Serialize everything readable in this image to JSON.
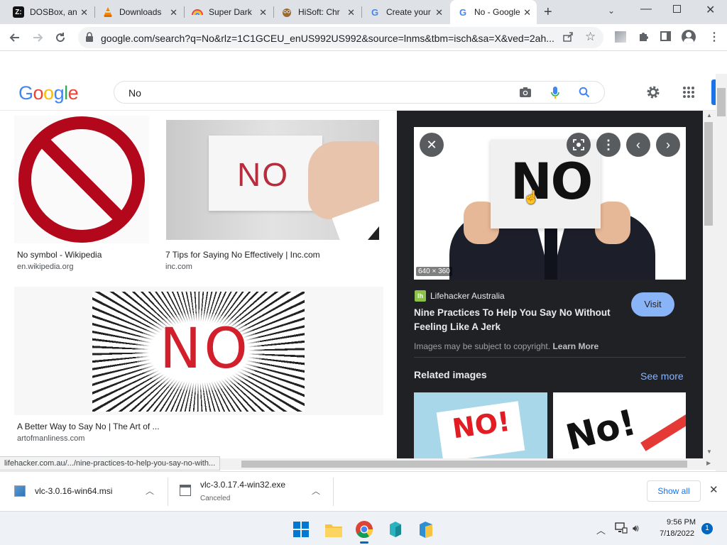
{
  "tabs": [
    {
      "title": "DOSBox, an",
      "icon": "dosbox-icon"
    },
    {
      "title": "Downloads",
      "icon": "vlc-icon"
    },
    {
      "title": "Super Dark",
      "icon": "rainbow-icon"
    },
    {
      "title": "HiSoft: Chr",
      "icon": "owl-icon"
    },
    {
      "title": "Create your",
      "icon": "google-icon"
    },
    {
      "title": "No - Google",
      "icon": "google-icon"
    }
  ],
  "url": "google.com/search?q=No&rlz=1C1GCEU_enUS992US992&source=lnms&tbm=isch&sa=X&ved=2ah...",
  "logo": {
    "g": "G",
    "o1": "o",
    "o2": "o",
    "g2": "g",
    "l": "l",
    "e": "e"
  },
  "search": {
    "query": "No"
  },
  "results": [
    {
      "title": "No symbol - Wikipedia",
      "source": "en.wikipedia.org"
    },
    {
      "title": "7 Tips for Saying No Effectively | Inc.com",
      "source": "inc.com"
    },
    {
      "title": "A Better Way to Say No | The Art of ...",
      "source": "artofmanliness.com"
    }
  ],
  "images": {
    "inc_text": "NO",
    "manly_text": "NO",
    "preview_text": "NO"
  },
  "panel": {
    "dimensions": "640 × 360",
    "site_name": "Lifehacker Australia",
    "site_logo_letter": "lh",
    "title_line1": "Nine Practices To Help You Say No Without",
    "title_line2": "Feeling Like A Jerk",
    "visit_label": "Visit",
    "copyright_text": "Images may be subject to copyright.",
    "learn_more": "Learn More",
    "related_label": "Related images",
    "see_more": "See more",
    "related1_text": "NO!",
    "related2_text": "No!"
  },
  "status_url": "lifehacker.com.au/.../nine-practices-to-help-you-say-no-with...",
  "downloads": [
    {
      "name": "vlc-3.0.16-win64.msi",
      "status": ""
    },
    {
      "name": "vlc-3.0.17.4-win32.exe",
      "status": "Canceled"
    }
  ],
  "show_all": "Show all",
  "clock": {
    "time": "9:56 PM",
    "date": "7/18/2022"
  },
  "notification_count": "1",
  "colors": {
    "google_blue": "#4285f4",
    "google_red": "#ea4335",
    "google_yellow": "#fbbc05",
    "google_green": "#34a853",
    "panel_bg": "#202124",
    "visit_btn": "#8ab4f8"
  }
}
